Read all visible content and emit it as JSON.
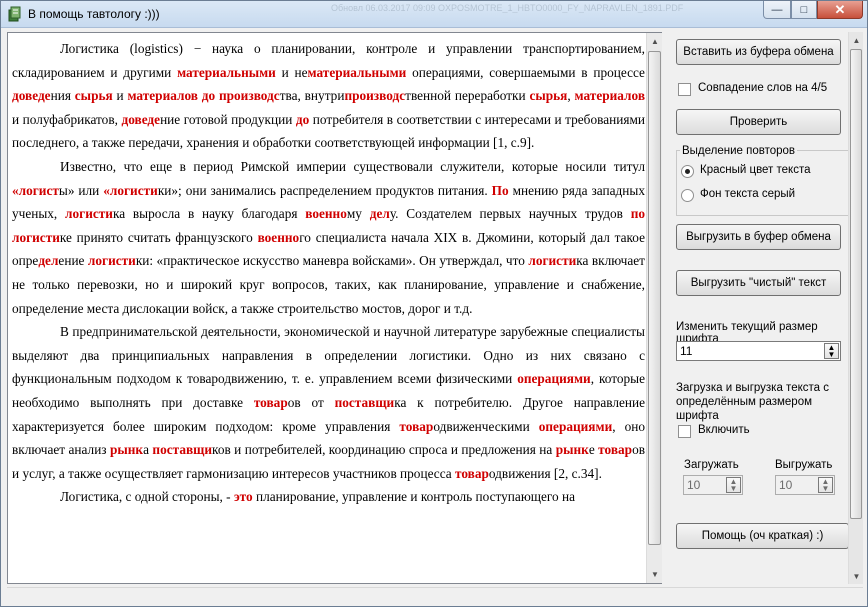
{
  "window": {
    "title": "В помощь тавтологу :)))",
    "background_titles": "Обновл  06.03.2017 09:09    OXPOSMOTRE_1_HBTO0000_FY_NAPRAVLEN_1891.PDF"
  },
  "editor": {
    "paragraphs": [
      [
        {
          "t": "Логистика (logistics) − наука о планировании, контроле и управлении транспортированием, складированием и другими "
        },
        {
          "t": "материальными",
          "h": true
        },
        {
          "t": " и не"
        },
        {
          "t": "материальными",
          "h": true
        },
        {
          "t": " операциями, совершаемыми в процессе "
        },
        {
          "t": "доведе",
          "h": true
        },
        {
          "t": "ния "
        },
        {
          "t": "сырья",
          "h": true
        },
        {
          "t": " и "
        },
        {
          "t": "материалов до производс",
          "h": true
        },
        {
          "t": "тва, внутри"
        },
        {
          "t": "производс",
          "h": true
        },
        {
          "t": "твенной переработки "
        },
        {
          "t": "сырья",
          "h": true
        },
        {
          "t": ", "
        },
        {
          "t": "материалов",
          "h": true
        },
        {
          "t": " и полуфабрикатов, "
        },
        {
          "t": "доведе",
          "h": true
        },
        {
          "t": "ние готовой продукции "
        },
        {
          "t": "до",
          "h": true
        },
        {
          "t": " потребителя в соответствии с интересами и требованиями последнего, а также передачи, хранения и обработки соответствующей информации [1, с.9]."
        }
      ],
      [
        {
          "t": "Известно, что еще в период Римской империи существовали служители, которые носили титул "
        },
        {
          "t": "«логист",
          "h": true
        },
        {
          "t": "ы» или "
        },
        {
          "t": "«логисти",
          "h": true
        },
        {
          "t": "ки»; они занимались распределением продуктов питания. "
        },
        {
          "t": "По",
          "h": true
        },
        {
          "t": " мнению ряда западных ученых, "
        },
        {
          "t": "логисти",
          "h": true
        },
        {
          "t": "ка выросла в науку благодаря "
        },
        {
          "t": "военно",
          "h": true
        },
        {
          "t": "му "
        },
        {
          "t": "дел",
          "h": true
        },
        {
          "t": "у. Создателем первых научных трудов "
        },
        {
          "t": "по логисти",
          "h": true
        },
        {
          "t": "ке принято считать французского "
        },
        {
          "t": "военно",
          "h": true
        },
        {
          "t": "го специалиста начала XIX в. Джомини, который дал такое опре"
        },
        {
          "t": "дел",
          "h": true
        },
        {
          "t": "ение "
        },
        {
          "t": "логисти",
          "h": true
        },
        {
          "t": "ки: «практическое искусство маневра войсками». Он утверждал, что "
        },
        {
          "t": "логисти",
          "h": true
        },
        {
          "t": "ка включает не только перевозки, но и широкий круг вопросов, таких, как планирование, управление и снабжение, определение места дислокации войск, а также строительство мостов, дорог и т.д."
        }
      ],
      [
        {
          "t": "В предпринимательской деятельности, экономической и научной литературе зарубежные специалисты выделяют два принципиальных направления в определении логистики. Одно из них связано с функциональным подходом к товародвижению, т. е. управлением всеми физическими "
        },
        {
          "t": "операциями",
          "h": true
        },
        {
          "t": ", которые необходимо выполнять при доставке "
        },
        {
          "t": "товар",
          "h": true
        },
        {
          "t": "ов от "
        },
        {
          "t": "поставщи",
          "h": true
        },
        {
          "t": "ка к потребителю. Другое направление характеризуется более широким подходом: кроме управления "
        },
        {
          "t": "товар",
          "h": true
        },
        {
          "t": "одвиженческими "
        },
        {
          "t": "операциями",
          "h": true
        },
        {
          "t": ", оно включает анализ "
        },
        {
          "t": "рынк",
          "h": true
        },
        {
          "t": "а "
        },
        {
          "t": "поставщи",
          "h": true
        },
        {
          "t": "ков и потребителей, координацию спроса и предложения на "
        },
        {
          "t": "рынк",
          "h": true
        },
        {
          "t": "е "
        },
        {
          "t": "товар",
          "h": true
        },
        {
          "t": "ов и услуг, а также осуществляет гармонизацию интересов участников процесса "
        },
        {
          "t": "товар",
          "h": true
        },
        {
          "t": "одвижения [2, с.34]."
        }
      ],
      [
        {
          "t": "Логистика, с одной стороны, - "
        },
        {
          "t": "это",
          "h": true
        },
        {
          "t": " планирование, управление и контроль поступающего на"
        }
      ]
    ]
  },
  "panel": {
    "paste_button": "Вставить из буфера обмена",
    "match_checkbox": {
      "label": "Совпадение слов на 4/5",
      "checked": false
    },
    "check_button": "Проверить",
    "highlight_group": {
      "title": "Выделение повторов",
      "options": [
        {
          "label": "Красный цвет текста",
          "selected": true
        },
        {
          "label": "Фон текста серый",
          "selected": false
        }
      ]
    },
    "export_button": "Выгрузить в буфер обмена",
    "export_clean_button": "Выгрузить \"чистый\" текст",
    "font_size_label": "Изменить текущий размер шрифта",
    "font_size_value": "11",
    "load_unload_label": "Загрузка и выгрузка текста с определённым размером шрифта",
    "enable_checkbox": {
      "label": "Включить",
      "checked": false
    },
    "load_label": "Загружать",
    "load_value": "10",
    "unload_label": "Выгружать",
    "unload_value": "10",
    "help_button": "Помощь (оч краткая) :)"
  },
  "colors": {
    "highlight": "#d00000",
    "titlebar": "#c7daef"
  }
}
